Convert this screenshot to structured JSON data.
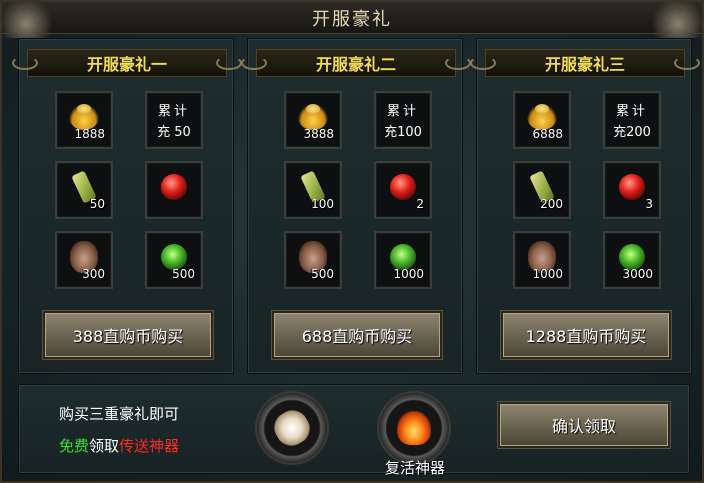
{
  "window": {
    "title": "开服豪礼"
  },
  "packs": [
    {
      "title": "开服豪礼一",
      "items": [
        {
          "icon": "gold-ingot-icon",
          "qty": "1888"
        },
        {
          "icon": "recharge-text",
          "line1": "累计",
          "line2": "充 50"
        },
        {
          "icon": "scroll-icon",
          "qty": "50"
        },
        {
          "icon": "red-gem-icon",
          "qty": ""
        },
        {
          "icon": "pine-cone-icon",
          "qty": "300"
        },
        {
          "icon": "green-orb-icon",
          "qty": "500"
        }
      ],
      "buy_label": "388直购币购买"
    },
    {
      "title": "开服豪礼二",
      "items": [
        {
          "icon": "gold-ingot-icon",
          "qty": "3888"
        },
        {
          "icon": "recharge-text",
          "line1": "累计",
          "line2": "充100"
        },
        {
          "icon": "scroll-icon",
          "qty": "100"
        },
        {
          "icon": "red-gem-icon",
          "qty": "2"
        },
        {
          "icon": "pine-cone-icon",
          "qty": "500"
        },
        {
          "icon": "green-orb-icon",
          "qty": "1000"
        }
      ],
      "buy_label": "688直购币购买"
    },
    {
      "title": "开服豪礼三",
      "items": [
        {
          "icon": "gold-ingot-icon",
          "qty": "6888"
        },
        {
          "icon": "recharge-text",
          "line1": "累计",
          "line2": "充200"
        },
        {
          "icon": "scroll-icon",
          "qty": "200"
        },
        {
          "icon": "red-gem-icon",
          "qty": "3"
        },
        {
          "icon": "pine-cone-icon",
          "qty": "1000"
        },
        {
          "icon": "green-orb-icon",
          "qty": "3000"
        }
      ],
      "buy_label": "1288直购币购买"
    }
  ],
  "bottom": {
    "promo_line1": "购买三重豪礼即可",
    "promo_free": "免费",
    "promo_get": "领取",
    "promo_artifact": "传送神器",
    "artifact1_icon": "teleport-glove-icon",
    "artifact2_icon": "revive-flame-icon",
    "artifact2_name": "复活神器",
    "confirm_label": "确认领取"
  }
}
